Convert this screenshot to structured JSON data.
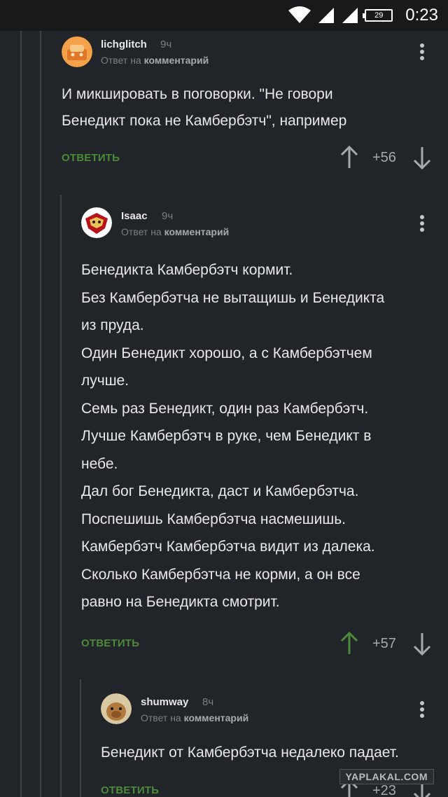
{
  "status_bar": {
    "time": "0:23",
    "battery": "29"
  },
  "comments": [
    {
      "username": "lichglitch",
      "time": "9ч",
      "reply_prefix": "Ответ на",
      "reply_target": "комментарий",
      "lines": [
        "И микшировать в поговорки. \"Не говори",
        "Бенедикт пока не Камбербэтч\", например"
      ],
      "reply_label": "ОТВЕТИТЬ",
      "score": "+56"
    },
    {
      "username": "Isaac",
      "time": "9ч",
      "reply_prefix": "Ответ на",
      "reply_target": "комментарий",
      "lines": [
        "Бенедикта Камбербэтч кормит.",
        "Без Камбербэтча не вытащишь и Бенедикта",
        "из пруда.",
        "Один Бенедикт хорошо, а с Камбербэтчем",
        "лучше.",
        "Семь раз Бенедикт, один раз Камбербэтч.",
        "Лучше Камбербэтч в руке, чем Бенедикт в",
        "небе.",
        "Дал бог Бенедикта, даст и Камбербэтча.",
        "Поспешишь Камбербэтча насмешишь.",
        "Камбербэтч Камбербэтча видит из далека.",
        "Сколько Камбербэтча не корми, а он все",
        "равно на Бенедикта смотрит."
      ],
      "reply_label": "ОТВЕТИТЬ",
      "score": "+57"
    },
    {
      "username": "shumway",
      "time": "8ч",
      "reply_prefix": "Ответ на",
      "reply_target": "комментарий",
      "lines": [
        "Бенедикт от Камбербэтча недалеко падает."
      ],
      "reply_label": "ОТВЕТИТЬ",
      "score": "+23"
    }
  ],
  "colors": {
    "background": "#212428",
    "reply": "#4d8a3a",
    "upvoted": "#4d8a3a",
    "muted": "#7c7f84"
  },
  "watermark": "YAPLAKAL.COM"
}
